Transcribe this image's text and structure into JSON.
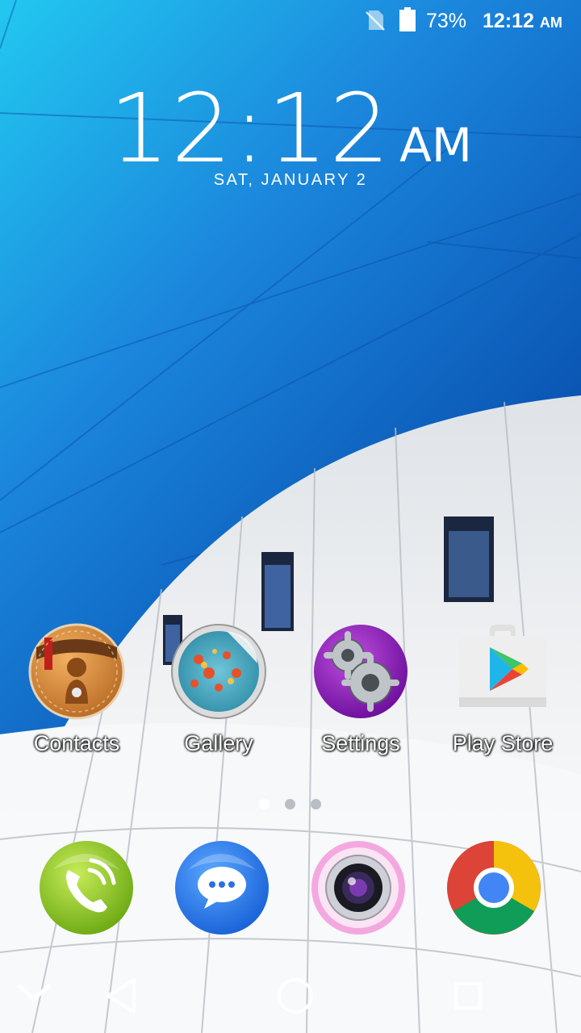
{
  "status_bar": {
    "battery_percent": "73%",
    "time": "12:12",
    "ampm": "AM"
  },
  "clock": {
    "time": "12:12",
    "ampm": "AM",
    "date": "SAT, JANUARY 2"
  },
  "apps": [
    {
      "label": "Contacts",
      "icon": "contacts-icon"
    },
    {
      "label": "Gallery",
      "icon": "gallery-icon"
    },
    {
      "label": "Settings",
      "icon": "settings-icon"
    },
    {
      "label": "Play Store",
      "icon": "play-store-icon"
    }
  ],
  "page_indicator": {
    "pages": 3,
    "current": 1
  },
  "dock": [
    "phone-icon",
    "messaging-icon",
    "camera-icon",
    "chrome-icon"
  ],
  "navigation": [
    "collapse-icon",
    "back-icon",
    "home-icon",
    "recents-icon"
  ],
  "colors": {
    "wallpaper_blue": "#1b7fd6",
    "wallpaper_white": "#e9ecef"
  }
}
